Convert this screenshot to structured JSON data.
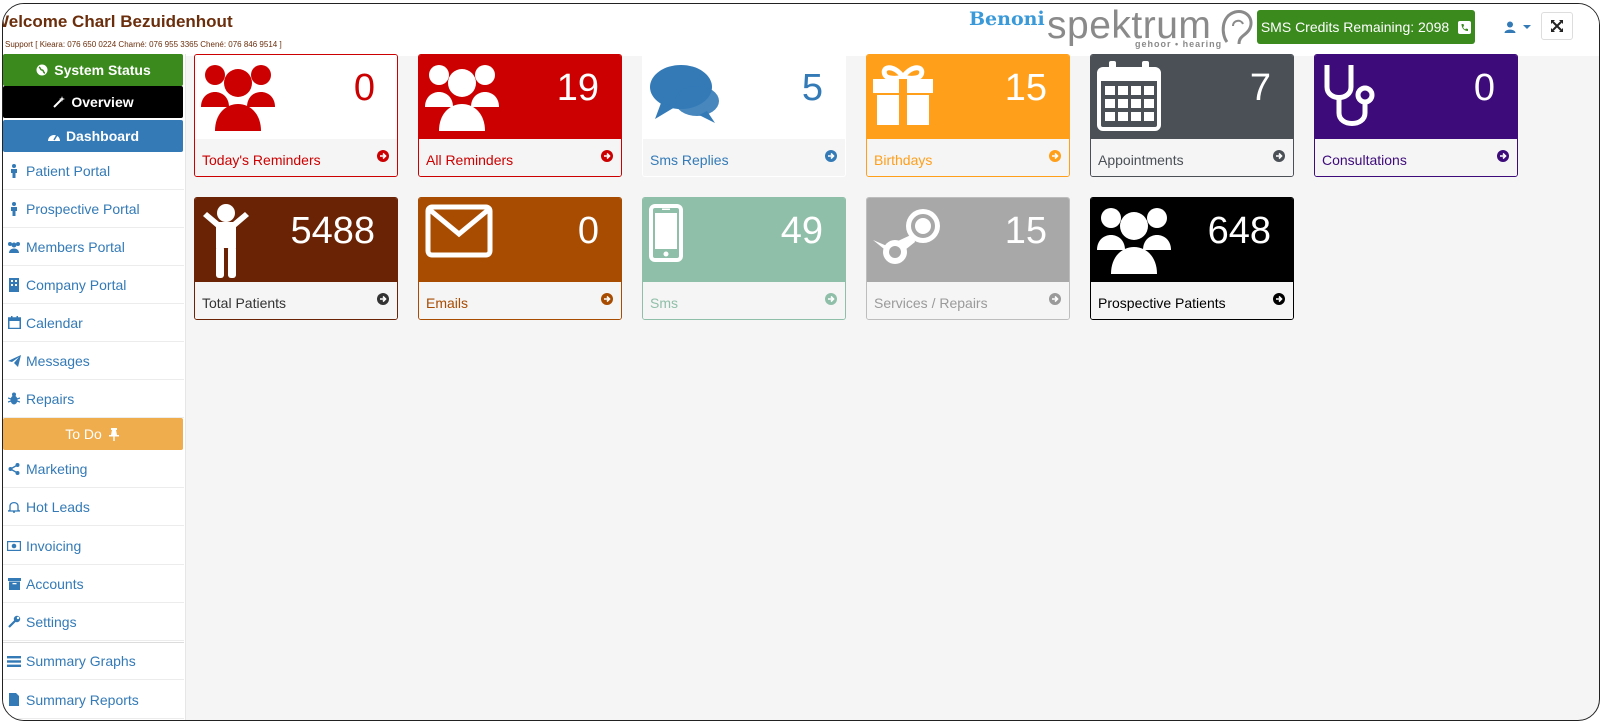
{
  "header": {
    "welcome": "Welcome Charl Bezuidenhout",
    "support": "Support [ Kieara: 076 650 0224 Charné: 076 955 3365 Chené: 076 846 9514 ]",
    "branch": "Benoni",
    "logo_word": "spektrum",
    "logo_tag": "gehoor • hearing",
    "sms_credits": "SMS Credits Remaining: 2098"
  },
  "colors": {
    "brand_brown": "#6b2e0c",
    "link_blue": "#337ab7",
    "success_green": "#3a8a1d",
    "todo_orange": "#f0ad4e"
  },
  "sidebar": {
    "system_status": "System Status",
    "overview": "Overview",
    "dashboard": "Dashboard",
    "todo": "To Do",
    "items": [
      {
        "label": "Patient Portal",
        "icon": "male-icon"
      },
      {
        "label": "Prospective Portal",
        "icon": "male-icon"
      },
      {
        "label": "Members Portal",
        "icon": "users-icon"
      },
      {
        "label": "Company Portal",
        "icon": "building-icon"
      },
      {
        "label": "Calendar",
        "icon": "calendar-icon"
      },
      {
        "label": "Messages",
        "icon": "paper-plane-icon"
      },
      {
        "label": "Repairs",
        "icon": "bug-icon"
      },
      {
        "label": "Marketing",
        "icon": "share-icon"
      },
      {
        "label": "Hot Leads",
        "icon": "bell-icon"
      },
      {
        "label": "Invoicing",
        "icon": "money-icon"
      },
      {
        "label": "Accounts",
        "icon": "archive-icon"
      },
      {
        "label": "Settings",
        "icon": "wrench-icon"
      },
      {
        "label": "Summary Graphs",
        "icon": "list-icon"
      },
      {
        "label": "Summary Reports",
        "icon": "file-icon"
      }
    ]
  },
  "tiles": [
    {
      "label": "Today's Reminders",
      "count": "0",
      "icon": "users-icon",
      "bg": "#ffffff",
      "fg": "#cc0000",
      "icon_color": "#cc0000",
      "border": "#cc0000",
      "foot_color": "#cc0000"
    },
    {
      "label": "All Reminders",
      "count": "19",
      "icon": "users-icon",
      "bg": "#cc0000",
      "fg": "#ffffff",
      "icon_color": "#ffffff",
      "border": "#cc0000",
      "foot_color": "#cc0000"
    },
    {
      "label": "Sms Replies",
      "count": "5",
      "icon": "comments-icon",
      "bg": "#ffffff",
      "fg": "#337ab7",
      "icon_color": "#337ab7",
      "border": "#ffffff",
      "foot_color": "#337ab7"
    },
    {
      "label": "Birthdays",
      "count": "15",
      "icon": "gift-icon",
      "bg": "#ff9f1a",
      "fg": "#ffffff",
      "icon_color": "#ffffff",
      "border": "#ff9f1a",
      "foot_color": "#ff9f1a"
    },
    {
      "label": "Appointments",
      "count": "7",
      "icon": "calendar-icon",
      "bg": "#4a5056",
      "fg": "#ffffff",
      "icon_color": "#ffffff",
      "border": "#4a5056",
      "foot_color": "#4a5056"
    },
    {
      "label": "Consultations",
      "count": "0",
      "icon": "stethoscope-icon",
      "bg": "#3d0b7a",
      "fg": "#ffffff",
      "icon_color": "#ffffff",
      "border": "#3d0b7a",
      "foot_color": "#3d0b7a"
    },
    {
      "label": "Total Patients",
      "count": "5488",
      "icon": "child-icon",
      "bg": "#6b2305",
      "fg": "#ffffff",
      "icon_color": "#ffffff",
      "border": "#6b2305",
      "foot_color": "#333333"
    },
    {
      "label": "Emails",
      "count": "0",
      "icon": "envelope-icon",
      "bg": "#a84c02",
      "fg": "#ffffff",
      "icon_color": "#ffffff",
      "border": "#a84c02",
      "foot_color": "#a84c02"
    },
    {
      "label": "Sms",
      "count": "49",
      "icon": "mobile-icon",
      "bg": "#8fbfa8",
      "fg": "#ffffff",
      "icon_color": "#ffffff",
      "border": "#8fbfa8",
      "foot_color": "#8fbfa8"
    },
    {
      "label": "Services / Repairs",
      "count": "15",
      "icon": "steam-icon",
      "bg": "#a8a8a8",
      "fg": "#ffffff",
      "icon_color": "#ffffff",
      "border": "#bdbdbd",
      "foot_color": "#9a9a9a"
    },
    {
      "label": "Prospective Patients",
      "count": "648",
      "icon": "users-icon",
      "bg": "#000000",
      "fg": "#ffffff",
      "icon_color": "#ffffff",
      "border": "#000000",
      "foot_color": "#000000"
    }
  ]
}
